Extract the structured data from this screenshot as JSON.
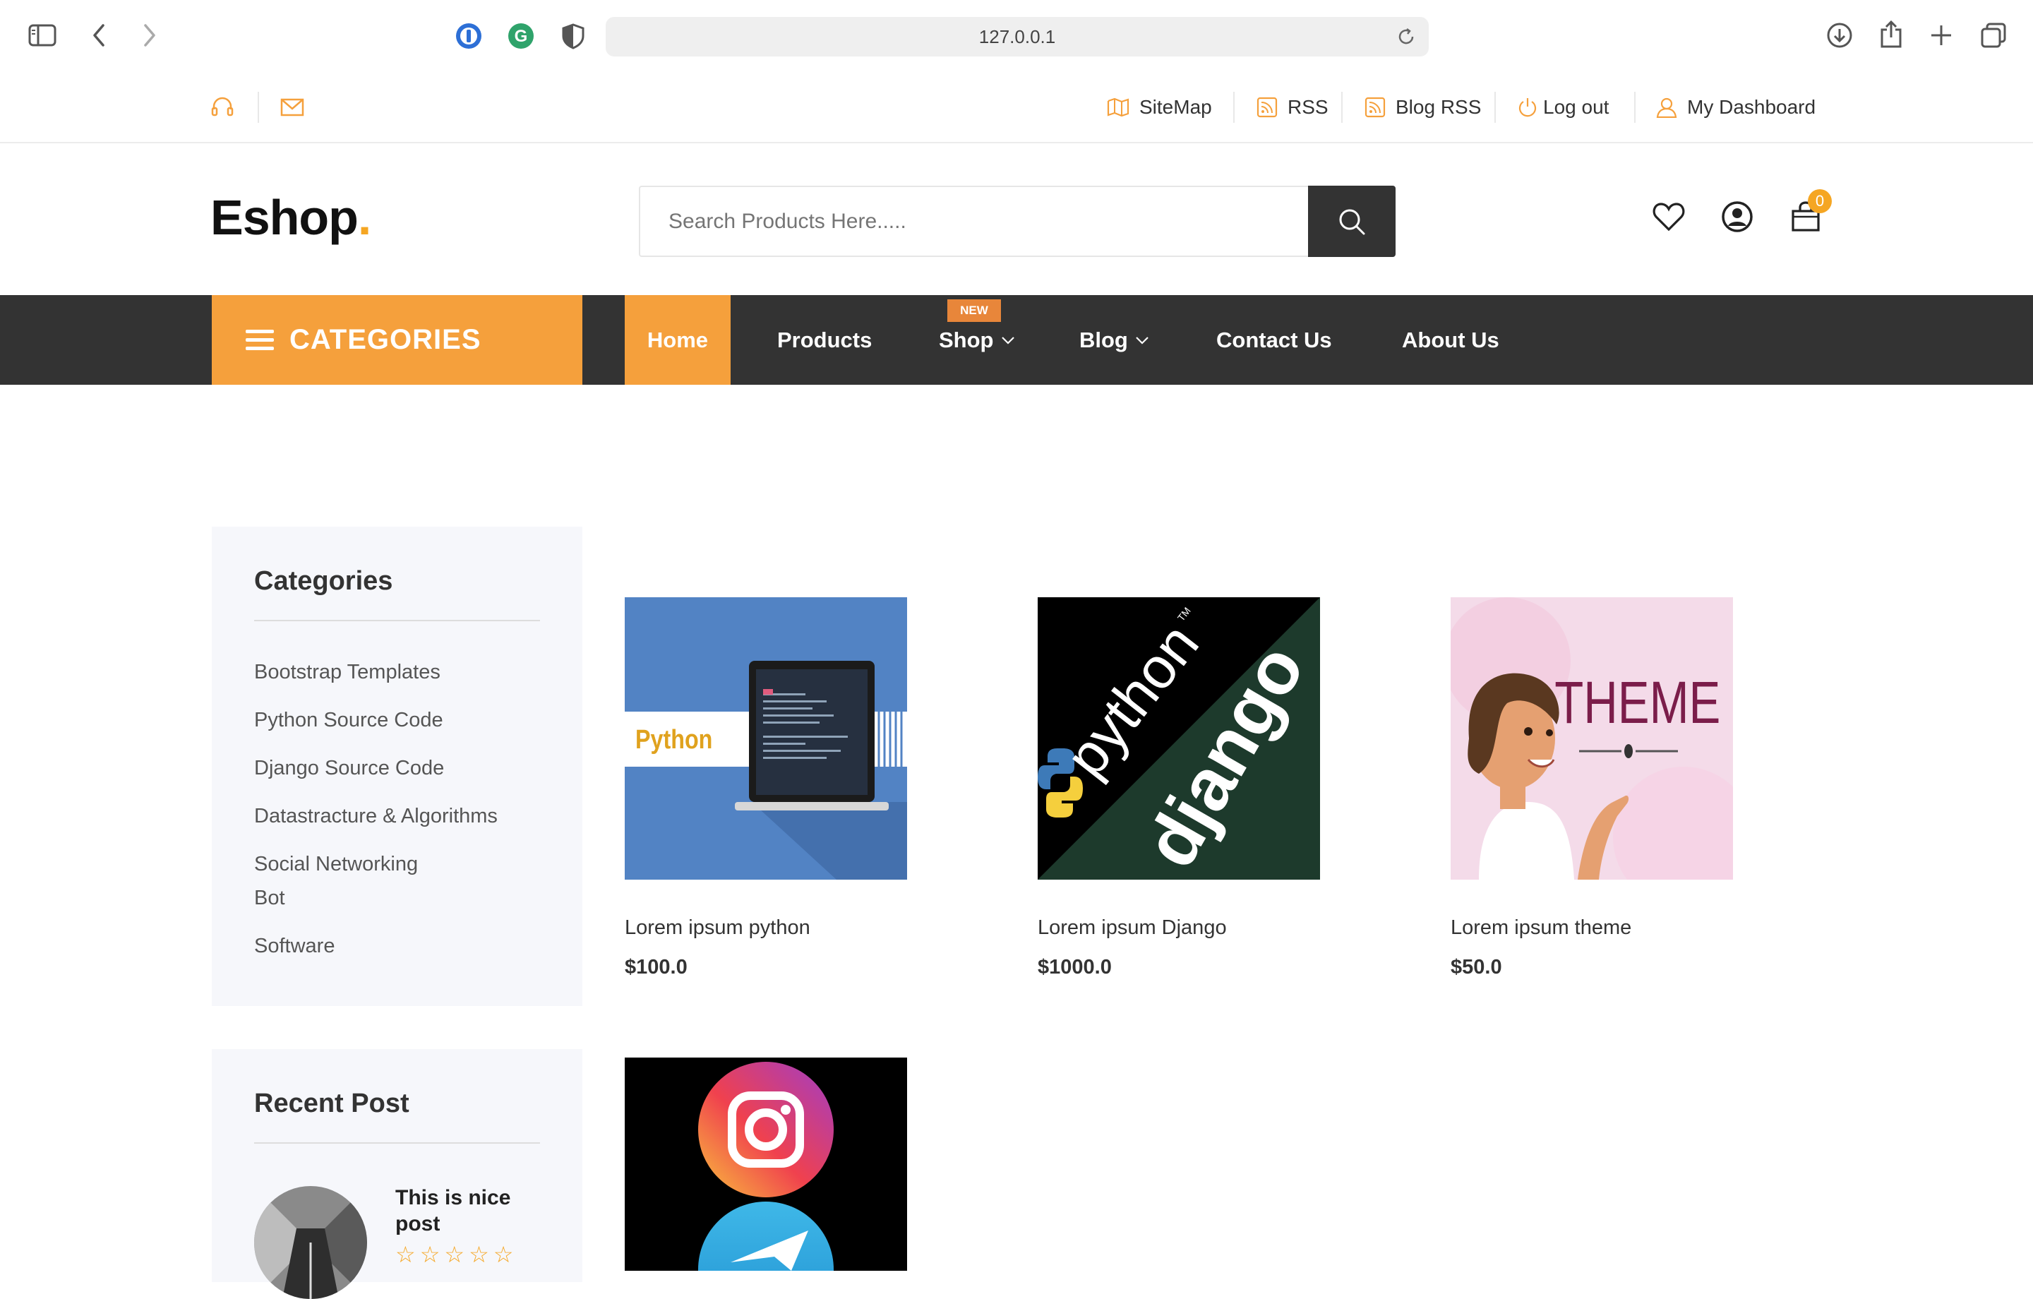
{
  "browser": {
    "url": "127.0.0.1"
  },
  "topbar": {
    "links": [
      {
        "label": "SiteMap",
        "icon": "map-icon"
      },
      {
        "label": "RSS",
        "icon": "rss-icon"
      },
      {
        "label": "Blog RSS",
        "icon": "rss-icon"
      },
      {
        "label": "Log out",
        "icon": "power-icon"
      },
      {
        "label": "My Dashboard",
        "icon": "user-icon"
      }
    ]
  },
  "header": {
    "logo": "Eshop",
    "logo_dot": ".",
    "search_placeholder": "Search Products Here.....",
    "cart_count": "0"
  },
  "nav": {
    "categories_label": "CATEGORIES",
    "items": [
      {
        "label": "Home",
        "active": true
      },
      {
        "label": "Products"
      },
      {
        "label": "Shop",
        "badge": "NEW",
        "dropdown": true
      },
      {
        "label": "Blog",
        "dropdown": true
      },
      {
        "label": "Contact Us"
      },
      {
        "label": "About Us"
      }
    ]
  },
  "sidebar": {
    "categories_title": "Categories",
    "categories": [
      "Bootstrap Templates",
      "Python Source Code",
      "Django Source Code",
      "Datastracture & Algorithms",
      "Social Networking",
      "Bot",
      "Software"
    ],
    "recent_title": "Recent Post",
    "recent_post": {
      "title": "This is nice post",
      "stars": "☆☆☆☆☆"
    }
  },
  "products": [
    {
      "name": "Lorem ipsum python",
      "price": "$100.0",
      "image_text": "Python"
    },
    {
      "name": "Lorem ipsum Django",
      "price": "$1000.0",
      "image_text_1": "python",
      "image_text_2": "django",
      "image_tm": "TM"
    },
    {
      "name": "Lorem ipsum theme",
      "price": "$50.0",
      "image_text": "THEME"
    },
    {
      "name": "",
      "price": ""
    }
  ],
  "colors": {
    "accent": "#f5a03c",
    "nav_bg": "#333333",
    "sidebar_bg": "#f6f7fb"
  }
}
